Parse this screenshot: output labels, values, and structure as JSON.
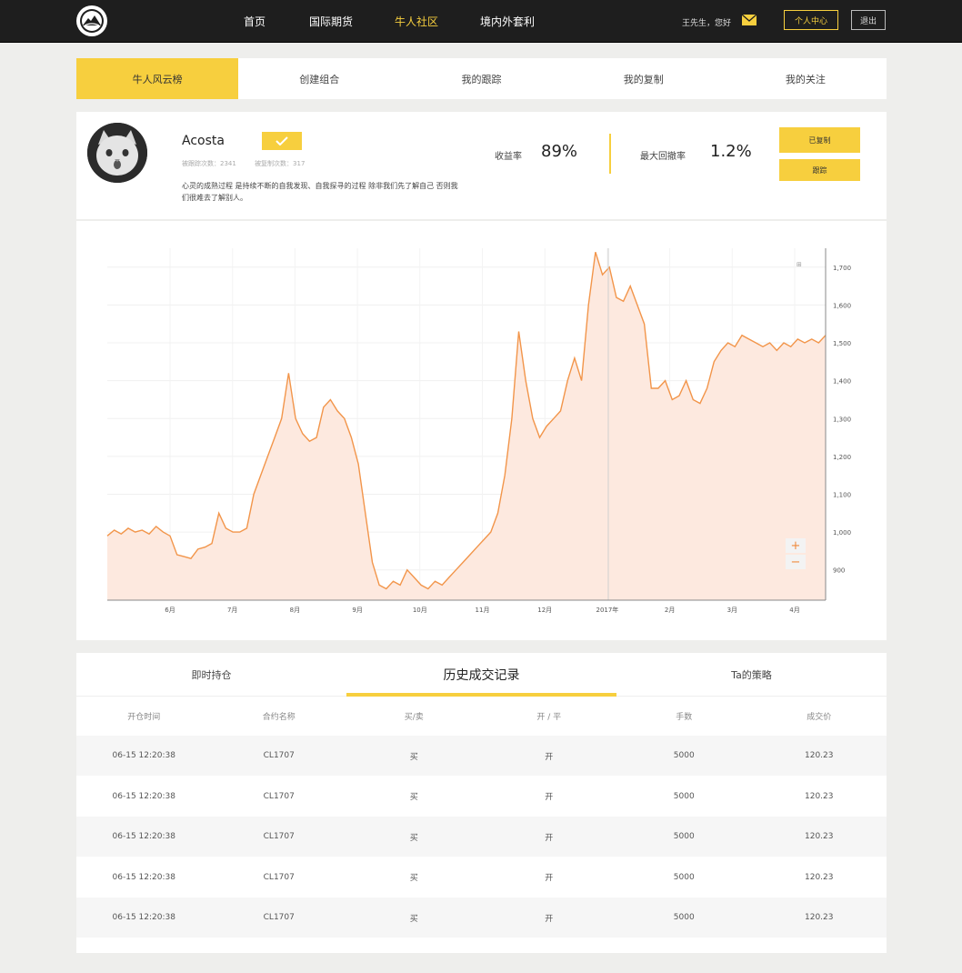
{
  "nav": {
    "items": [
      {
        "label": "首页",
        "active": false
      },
      {
        "label": "国际期货",
        "active": false
      },
      {
        "label": "牛人社区",
        "active": true
      },
      {
        "label": "境内外套利",
        "active": false
      }
    ],
    "greeting": "王先生，您好",
    "user_center": "个人中心",
    "logout": "退出"
  },
  "subtabs": [
    {
      "label": "牛人风云榜",
      "active": true
    },
    {
      "label": "创建组合",
      "active": false
    },
    {
      "label": "我的跟踪",
      "active": false
    },
    {
      "label": "我的复制",
      "active": false
    },
    {
      "label": "我的关注",
      "active": false
    }
  ],
  "profile": {
    "name": "Acosta",
    "followed_label": "被跟踪次数：2341",
    "copied_label": "被复制次数：317",
    "bio": "心灵的成熟过程 是持续不断的自我发现、自我探寻的过程 除非我们先了解自己 否则我们很难去了解别人。",
    "return_label": "收益率",
    "return_value": "89%",
    "drawdown_label": "最大回撤率",
    "drawdown_value": "1.2%",
    "copied_button": "已复制",
    "follow_button": "跟踪"
  },
  "chart_data": {
    "type": "area",
    "x_ticks": [
      "6月",
      "7月",
      "8月",
      "9月",
      "10月",
      "11月",
      "12月",
      "2017年",
      "2月",
      "3月",
      "4月"
    ],
    "y_ticks": [
      "900",
      "1,000",
      "1,100",
      "1,200",
      "1,300",
      "1,400",
      "1,500",
      "1,600",
      "1,700"
    ],
    "ylim": [
      820,
      1750
    ],
    "grid": true,
    "line_color": "#f2954a",
    "fill_color": "#fde9df",
    "values": [
      990,
      1005,
      995,
      1010,
      1000,
      1005,
      995,
      1015,
      1000,
      990,
      940,
      935,
      930,
      955,
      960,
      970,
      1050,
      1010,
      1000,
      1000,
      1010,
      1100,
      1150,
      1200,
      1250,
      1300,
      1420,
      1300,
      1260,
      1240,
      1250,
      1330,
      1350,
      1320,
      1300,
      1250,
      1180,
      1050,
      920,
      860,
      850,
      870,
      860,
      900,
      880,
      860,
      850,
      870,
      860,
      880,
      900,
      920,
      940,
      960,
      980,
      1000,
      1050,
      1150,
      1300,
      1530,
      1400,
      1300,
      1250,
      1280,
      1300,
      1320,
      1400,
      1460,
      1400,
      1600,
      1740,
      1680,
      1700,
      1620,
      1610,
      1650,
      1600,
      1550,
      1380,
      1380,
      1400,
      1350,
      1360,
      1400,
      1350,
      1340,
      1380,
      1450,
      1480,
      1500,
      1490,
      1520,
      1510,
      1500,
      1490,
      1500,
      1480,
      1500,
      1490,
      1510,
      1500,
      1510,
      1500,
      1520
    ],
    "annotation": "⊞"
  },
  "panel": {
    "tabs": [
      {
        "label": "即时持仓",
        "active": false
      },
      {
        "label": "历史成交记录",
        "active": true
      },
      {
        "label": "Ta的策略",
        "active": false
      }
    ],
    "columns": [
      "开仓时间",
      "合约名称",
      "买/卖",
      "开 / 平",
      "手数",
      "成交价"
    ],
    "rows": [
      [
        "06-15 12:20:38",
        "CL1707",
        "买",
        "开",
        "5000",
        "120.23"
      ],
      [
        "06-15 12:20:38",
        "CL1707",
        "买",
        "开",
        "5000",
        "120.23"
      ],
      [
        "06-15 12:20:38",
        "CL1707",
        "买",
        "开",
        "5000",
        "120.23"
      ],
      [
        "06-15 12:20:38",
        "CL1707",
        "买",
        "开",
        "5000",
        "120.23"
      ],
      [
        "06-15 12:20:38",
        "CL1707",
        "买",
        "开",
        "5000",
        "120.23"
      ]
    ]
  },
  "icons": {
    "logo": "mountain-logo-icon",
    "mail": "mail-icon",
    "verified": "check-icon",
    "zoom_in": "plus-icon",
    "zoom_out": "minus-icon"
  },
  "colors": {
    "accent": "#f7cf3e",
    "nav_bg": "#1e1e1e",
    "line": "#f2954a"
  }
}
